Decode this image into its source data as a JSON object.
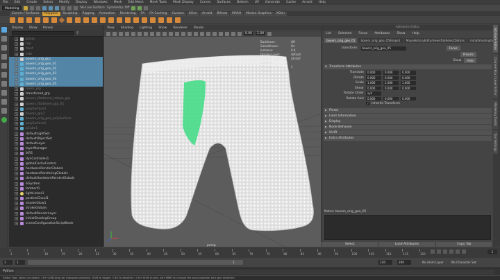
{
  "menubar": [
    "File",
    "Edit",
    "Create",
    "Select",
    "Modify",
    "Display",
    "Windows",
    "Mesh",
    "Edit Mesh",
    "Mesh Tools",
    "Mesh Display",
    "Curves",
    "Surfaces",
    "Deform",
    "UV",
    "Generate",
    "Cache",
    "Arnold",
    "Help"
  ],
  "status": {
    "mode": "Modeling",
    "live_surface": "No Live Surface",
    "symmetry": "Symmetry: Off"
  },
  "shelf_tabs": [
    {
      "label": "Curves / Surfaces",
      "active": false
    },
    {
      "label": "Polygons",
      "active": true
    },
    {
      "label": "Sculpting",
      "active": false
    },
    {
      "label": "Rigging",
      "active": false
    },
    {
      "label": "Animation",
      "active": false
    },
    {
      "label": "Rendering",
      "active": false
    },
    {
      "label": "FX",
      "active": false
    },
    {
      "label": "FX Caching",
      "active": false
    },
    {
      "label": "Custom",
      "active": false
    },
    {
      "label": "XGen",
      "active": false
    },
    {
      "label": "Arnold",
      "active": false
    },
    {
      "label": "Bifrost",
      "active": false
    },
    {
      "label": "MASH",
      "active": false
    },
    {
      "label": "Motion Graphics",
      "active": false
    },
    {
      "label": "XGen",
      "active": false
    }
  ],
  "outliner": {
    "menu": [
      "Display",
      "Show",
      "Panels"
    ],
    "items": [
      {
        "label": "group",
        "type": "grp",
        "selected": false,
        "dim": true
      },
      {
        "label": "top",
        "type": "grp",
        "selected": false,
        "dim": true
      },
      {
        "label": "front",
        "type": "grp",
        "selected": false,
        "dim": true
      },
      {
        "label": "side",
        "type": "grp",
        "selected": false,
        "dim": true
      },
      {
        "label": "boxers_orig_grp",
        "type": "grp",
        "selected": true,
        "dim": false
      },
      {
        "label": "boxers_orig_geo_01",
        "type": "mesh",
        "selected": true,
        "dim": false
      },
      {
        "label": "boxers_orig_geo_02",
        "type": "mesh",
        "selected": true,
        "dim": false
      },
      {
        "label": "boxers_orig_geo_03",
        "type": "mesh",
        "selected": true,
        "dim": false
      },
      {
        "label": "boxers_orig_geo_04",
        "type": "mesh",
        "selected": true,
        "dim": false
      },
      {
        "label": "boxers_orig_geo_05",
        "type": "mesh",
        "selected": true,
        "dim": false
      },
      {
        "label": "mesh_grp",
        "type": "grp",
        "selected": false,
        "dim": true
      },
      {
        "label": "transferred_grp",
        "type": "grp",
        "selected": false,
        "dim": false
      },
      {
        "label": "boxers_flattened_retopo_grp",
        "type": "grp",
        "selected": false,
        "dim": true
      },
      {
        "label": "boxers_flattened_grp_01",
        "type": "grp",
        "selected": false,
        "dim": true
      },
      {
        "label": "polySurface1",
        "type": "mesh",
        "selected": false,
        "dim": true
      },
      {
        "label": "boxers_grp1",
        "type": "grp",
        "selected": false,
        "dim": true
      },
      {
        "label": "boxers_orig_geo_polySurface",
        "type": "mesh",
        "selected": false,
        "dim": true
      },
      {
        "label": "polySurface1",
        "type": "mesh",
        "selected": false,
        "dim": true
      },
      {
        "label": "pCube1",
        "type": "mesh",
        "selected": false,
        "dim": true
      },
      {
        "label": "defaultLightSet",
        "type": "set",
        "selected": false,
        "dim": false
      },
      {
        "label": "defaultObjectSet",
        "type": "set",
        "selected": false,
        "dim": false
      },
      {
        "label": "defaultLayer",
        "type": "set",
        "selected": false,
        "dim": false
      },
      {
        "label": "layerManager",
        "type": "set",
        "selected": false,
        "dim": false
      },
      {
        "label": "ikRS",
        "type": "set",
        "selected": false,
        "dim": false
      },
      {
        "label": "dynController1",
        "type": "set",
        "selected": false,
        "dim": false
      },
      {
        "label": "globalCacheControl",
        "type": "set",
        "selected": false,
        "dim": false
      },
      {
        "label": "hardwareRenderGlobals",
        "type": "set",
        "selected": false,
        "dim": false
      },
      {
        "label": "hardwareRenderingGlobals",
        "type": "set",
        "selected": false,
        "dim": false
      },
      {
        "label": "defaultHardwareRenderGlobals",
        "type": "set",
        "selected": false,
        "dim": false
      },
      {
        "label": "ikSystem",
        "type": "set",
        "selected": false,
        "dim": false
      },
      {
        "label": "lambert1",
        "type": "set",
        "selected": false,
        "dim": false
      },
      {
        "label": "lightLinker1",
        "type": "light",
        "selected": false,
        "dim": false
      },
      {
        "label": "particleCloud1",
        "type": "set",
        "selected": false,
        "dim": false
      },
      {
        "label": "shaderGlow1",
        "type": "set",
        "selected": false,
        "dim": false
      },
      {
        "label": "strokeGlobals",
        "type": "set",
        "selected": false,
        "dim": false
      },
      {
        "label": "defaultRenderLayer",
        "type": "set",
        "selected": false,
        "dim": false
      },
      {
        "label": "initialShadingGroup",
        "type": "set",
        "selected": false,
        "dim": false
      },
      {
        "label": "sceneConfigurationScriptNode",
        "type": "set",
        "selected": false,
        "dim": false
      }
    ]
  },
  "viewport": {
    "menu": [
      "View",
      "Shading",
      "Lighting",
      "Show",
      "Renderer",
      "Panels"
    ],
    "field_a": "0.00",
    "field_b": "1.00",
    "camera": "persp",
    "hud": [
      {
        "label": "Backfaces:",
        "value": "Off"
      },
      {
        "label": "Smoothness:",
        "value": "On"
      },
      {
        "label": "Instance:",
        "value": "0.8"
      },
      {
        "label": "Display Layer:",
        "value": "default"
      },
      {
        "label": "Distance From Camera:",
        "value": "26.047"
      },
      {
        "label": "Selected Objects:",
        "value": "1"
      }
    ]
  },
  "attribute_editor": {
    "title": "Attribute Editor",
    "menu": [
      "List",
      "Selected",
      "Focus",
      "Attributes",
      "Show",
      "Help"
    ],
    "tabs": [
      {
        "label": "boxers_orig_geo_05",
        "active": true
      },
      {
        "label": "boxers_orig_geo_05Shape1",
        "active": false
      },
      {
        "label": "MayaHistoryEditorSewnTabSelectDetails",
        "active": false
      },
      {
        "label": "initialShadingGroup",
        "active": false
      }
    ],
    "transform_label": "transform:",
    "transform_value": "boxers_orig_geo_05",
    "focus_btn": "Focus",
    "presets_btn": "Presets",
    "show_label": "Show",
    "hide_btn": "Hide",
    "sections": {
      "transform_attributes": "Transform Attributes",
      "collapsed": [
        "Pivots",
        "Limit Information",
        "Display",
        "Node Behavior",
        "UUID",
        "Extra Attributes"
      ]
    },
    "attrs": [
      {
        "label": "Translate",
        "values": [
          "0.000",
          "0.000",
          "0.000"
        ]
      },
      {
        "label": "Rotate",
        "values": [
          "0.000",
          "0.000",
          "0.000"
        ]
      },
      {
        "label": "Scale",
        "values": [
          "1.000",
          "1.000",
          "1.000"
        ]
      },
      {
        "label": "Shear",
        "values": [
          "0.000",
          "0.000",
          "0.000"
        ]
      }
    ],
    "rotate_order_label": "Rotate Order",
    "rotate_order_value": "xyz",
    "rotate_axis_label": "Rotate Axis",
    "rotate_axis_values": [
      "0.000",
      "0.000",
      "0.000"
    ],
    "inherits_label": "Inherits Transform",
    "notes_label": "Notes: boxers_orig_geo_05",
    "buttons": [
      "Select",
      "Load Attributes",
      "Copy Tab"
    ]
  },
  "right_tabs": [
    "Attribute Editor",
    "Channel Box / Layer Editor",
    "Modeling Toolkit",
    "Tool Settings"
  ],
  "timeline": {
    "ticks": [
      "1",
      "5",
      "10",
      "15",
      "20",
      "25",
      "30",
      "35",
      "40",
      "45",
      "50",
      "55",
      "60",
      "65",
      "70",
      "75",
      "80",
      "85",
      "90",
      "95",
      "100",
      "105",
      "110",
      "115",
      "120"
    ],
    "current_frame": "1"
  },
  "range": {
    "start": "1",
    "inner_start": "1",
    "inner_end": "120",
    "bar_label": "1",
    "end_a": "120",
    "end_b": "200",
    "anim_layer": "No Anim Layer",
    "char_set": "No Character Set",
    "fps": "24 fps"
  },
  "command": {
    "label": "Python",
    "help": "Select Tool: select an object. Ctrl+LMB-drag for marquee selection. Shift to toggle / Ctrl to deselect / Ctrl+Shift to add, Alt+MMB to change the pivot position and spin direction."
  },
  "colors": {
    "accent_tab": "#d8a23a",
    "selection": "#5285a6",
    "highlight_mesh": "#3ddc84"
  }
}
